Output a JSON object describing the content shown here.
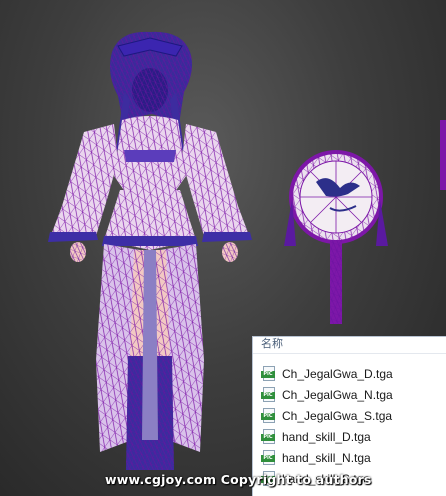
{
  "viewport": {
    "background": "#3a3a3a",
    "wire_color": "#7d17a8",
    "wire_dark": "#3f2a9c",
    "skin_color": "#f2c9c3",
    "cloth_color": "#ead6ee"
  },
  "file_panel": {
    "column_header": "名称",
    "files": [
      {
        "icon": "pic-icon",
        "icon_text": "PIC",
        "name": "Ch_JegalGwa_D.tga"
      },
      {
        "icon": "pic-icon",
        "icon_text": "PIC",
        "name": "Ch_JegalGwa_N.tga"
      },
      {
        "icon": "pic-icon",
        "icon_text": "PIC",
        "name": "Ch_JegalGwa_S.tga"
      },
      {
        "icon": "pic-icon",
        "icon_text": "PIC",
        "name": "hand_skill_D.tga"
      },
      {
        "icon": "pic-icon",
        "icon_text": "PIC",
        "name": "hand_skill_N.tga"
      },
      {
        "icon": "pic-icon",
        "icon_text": "PIC",
        "name": "hand_skill_S.tga"
      }
    ]
  },
  "watermark": {
    "text": "www.cgjoy.com Copyright to authors"
  }
}
